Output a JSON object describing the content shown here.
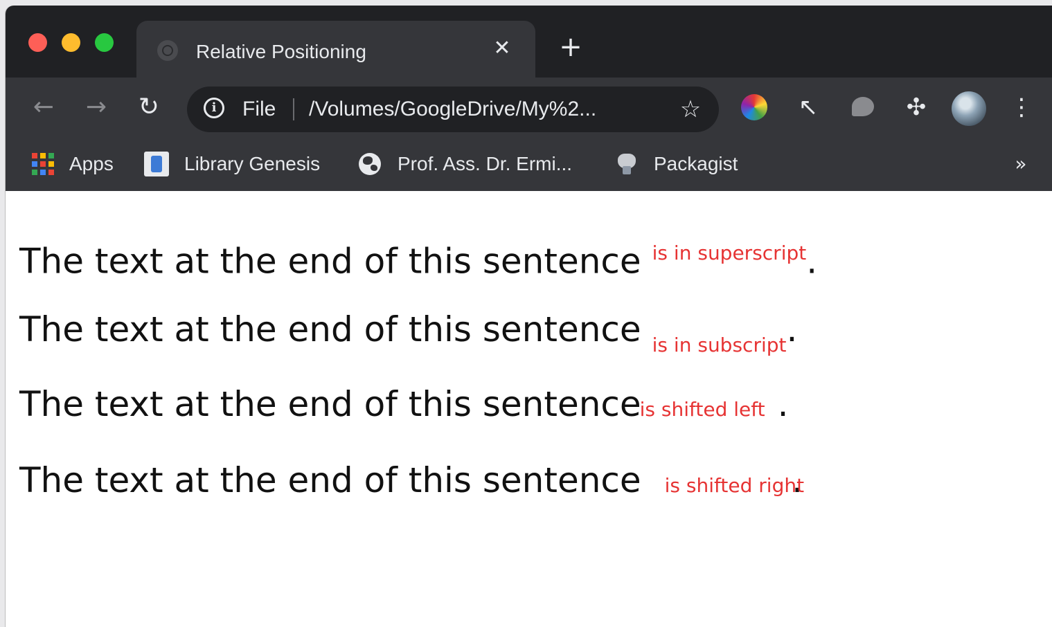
{
  "browser": {
    "tab_title": "Relative Positioning",
    "tab_close": "✕",
    "new_tab": "+",
    "omnibox": {
      "scheme_label": "File",
      "url": "/Volumes/GoogleDrive/My%2..."
    },
    "bookmarks": [
      {
        "label": "Apps",
        "icon": "apps-grid-icon"
      },
      {
        "label": "Library Genesis",
        "icon": "library-genesis-icon"
      },
      {
        "label": "Prof. Ass. Dr. Ermi...",
        "icon": "globe-icon"
      },
      {
        "label": "Packagist",
        "icon": "packagist-icon"
      }
    ],
    "bookmarks_overflow": "»",
    "icons": {
      "back": "←",
      "forward": "→",
      "reload": "↻",
      "info": "i",
      "star": "☆",
      "cursor": "↖",
      "puzzle": "✣",
      "menu": "⋮"
    }
  },
  "page": {
    "base_text": "The text at the end of this sentence",
    "period": ".",
    "lines": [
      {
        "label": "is in superscript"
      },
      {
        "label": "is in subscript"
      },
      {
        "label": "is shifted left"
      },
      {
        "label": "is shifted right"
      }
    ]
  },
  "colors": {
    "chrome_dark": "#202124",
    "chrome_toolbar": "#35363a",
    "highlight_text": "#e63333"
  }
}
